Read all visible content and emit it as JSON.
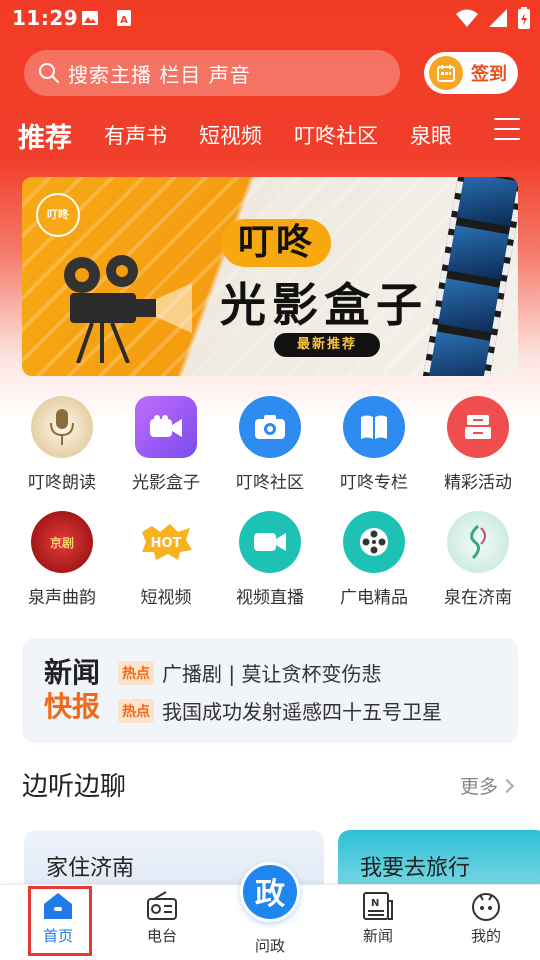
{
  "status": {
    "time": "11:29"
  },
  "search": {
    "placeholder": "搜索主播 栏目 声音"
  },
  "sign_in": {
    "label": "签到"
  },
  "tabs": [
    {
      "label": "推荐",
      "active": true
    },
    {
      "label": "有声书"
    },
    {
      "label": "短视频"
    },
    {
      "label": "叮咚社区"
    },
    {
      "label": "泉眼"
    }
  ],
  "banner": {
    "logo_text": "叮咚",
    "brand": "叮咚",
    "title": "光影盒子",
    "badge": "最新推荐"
  },
  "grid": [
    {
      "label": "叮咚朗读",
      "icon": "microphone-icon",
      "color": "#e9d7b5"
    },
    {
      "label": "光影盒子",
      "icon": "video-camera-icon",
      "color": "#9b5cf5"
    },
    {
      "label": "叮咚社区",
      "icon": "camera-icon",
      "color": "#2e8cf0"
    },
    {
      "label": "叮咚专栏",
      "icon": "book-icon",
      "color": "#2e8cf0"
    },
    {
      "label": "精彩活动",
      "icon": "activity-icon",
      "color": "#f04e4e"
    },
    {
      "label": "泉声曲韵",
      "icon": "opera-icon",
      "color": "#c8102e"
    },
    {
      "label": "短视频",
      "icon": "hot-icon",
      "color": "#ffffff"
    },
    {
      "label": "视频直播",
      "icon": "live-camera-icon",
      "color": "#1ec2b5"
    },
    {
      "label": "广电精品",
      "icon": "film-reel-icon",
      "color": "#1ec2b5"
    },
    {
      "label": "泉在济南",
      "icon": "spring-icon",
      "color": "#d7f0e8"
    }
  ],
  "news": {
    "brand_line1": "新闻",
    "brand_line2": "快报",
    "items": [
      {
        "tag": "热点",
        "text": "广播剧 | 莫让贪杯变伤悲"
      },
      {
        "tag": "热点",
        "text": "我国成功发射遥感四十五号卫星"
      }
    ]
  },
  "section": {
    "title": "边听边聊",
    "more": "更多"
  },
  "cards": [
    {
      "title": "家住济南"
    },
    {
      "title": "我要去旅行"
    }
  ],
  "bottom_nav": [
    {
      "label": "首页",
      "icon": "home-icon",
      "active": true
    },
    {
      "label": "电台",
      "icon": "radio-icon"
    },
    {
      "label": "问政",
      "icon": "politics-icon",
      "glyph": "政"
    },
    {
      "label": "新闻",
      "icon": "newspaper-icon"
    },
    {
      "label": "我的",
      "icon": "profile-icon"
    }
  ],
  "colors": {
    "primary_red": "#f23b25",
    "accent_blue": "#1e7be8",
    "hot_orange": "#ef6a1a"
  }
}
